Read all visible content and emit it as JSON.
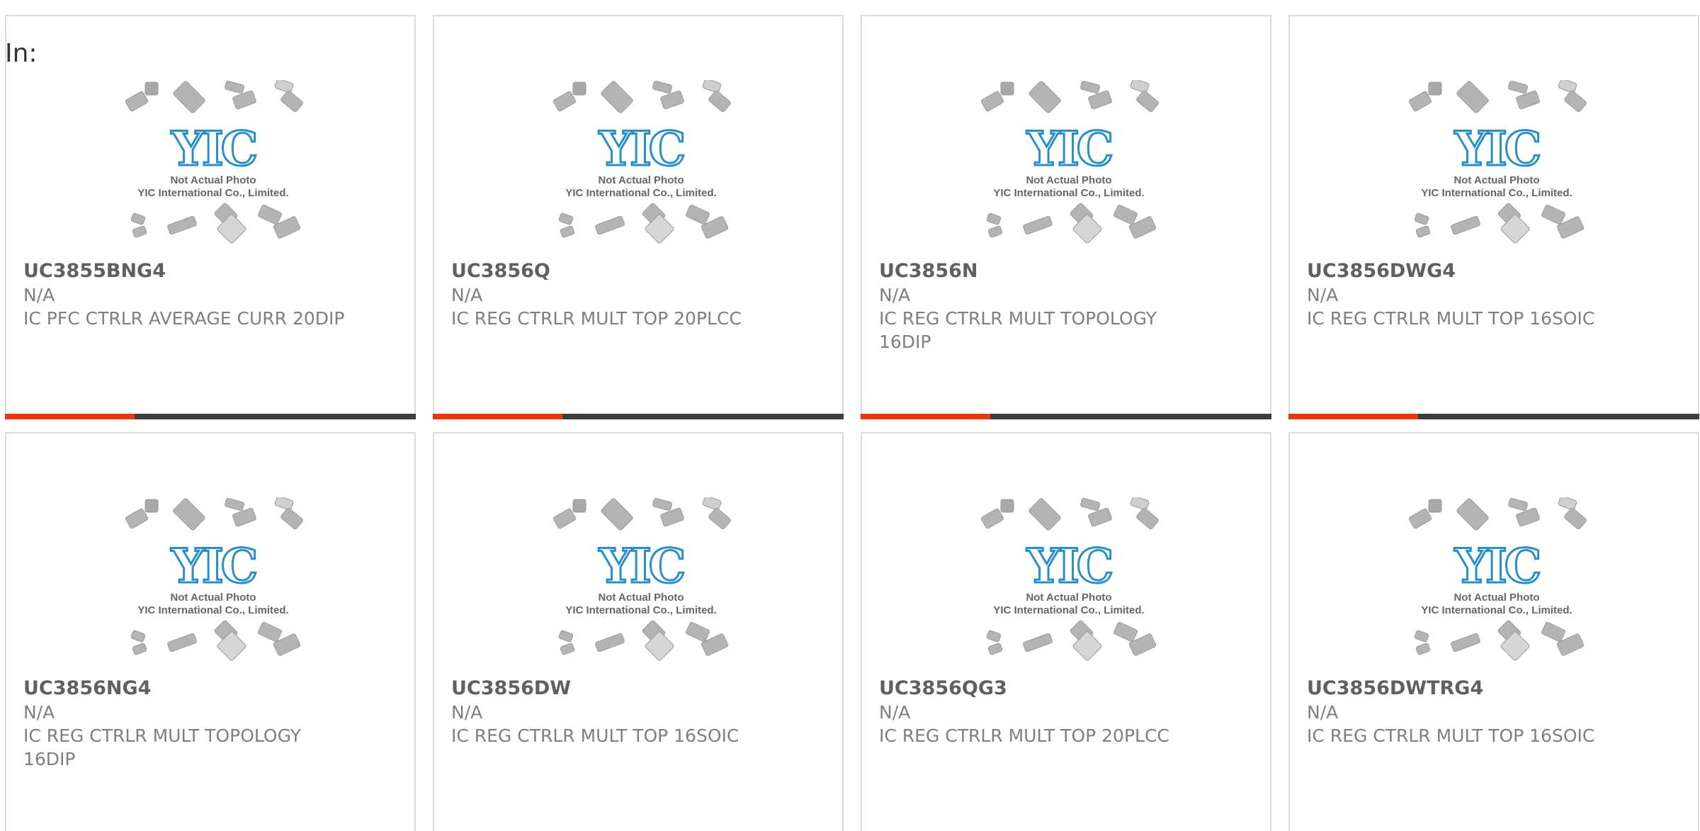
{
  "filter_label": "In:",
  "photo": {
    "line1": "Not Actual Photo",
    "line2": "YIC International Co., Limited.",
    "logo": "YIC"
  },
  "colors": {
    "accent": "#e8380d",
    "bar_dark": "#3e3e3e",
    "logo_blue": "#2a8fc8",
    "chip_gray": "#b4b4b4",
    "text_gray": "#7f7f7f"
  },
  "products": [
    {
      "part": "UC3855BNG4",
      "manufacturer": "N/A",
      "description": "IC PFC CTRLR AVERAGE CURR 20DIP"
    },
    {
      "part": "UC3856Q",
      "manufacturer": "N/A",
      "description": "IC REG CTRLR MULT TOP 20PLCC"
    },
    {
      "part": "UC3856N",
      "manufacturer": "N/A",
      "description": "IC REG CTRLR MULT TOPOLOGY 16DIP"
    },
    {
      "part": "UC3856DWG4",
      "manufacturer": "N/A",
      "description": "IC REG CTRLR MULT TOP 16SOIC"
    },
    {
      "part": "UC3856NG4",
      "manufacturer": "N/A",
      "description": "IC REG CTRLR MULT TOPOLOGY 16DIP"
    },
    {
      "part": "UC3856DW",
      "manufacturer": "N/A",
      "description": "IC REG CTRLR MULT TOP 16SOIC"
    },
    {
      "part": "UC3856QG3",
      "manufacturer": "N/A",
      "description": "IC REG CTRLR MULT TOP 20PLCC"
    },
    {
      "part": "UC3856DWTRG4",
      "manufacturer": "N/A",
      "description": "IC REG CTRLR MULT TOP 16SOIC"
    }
  ]
}
